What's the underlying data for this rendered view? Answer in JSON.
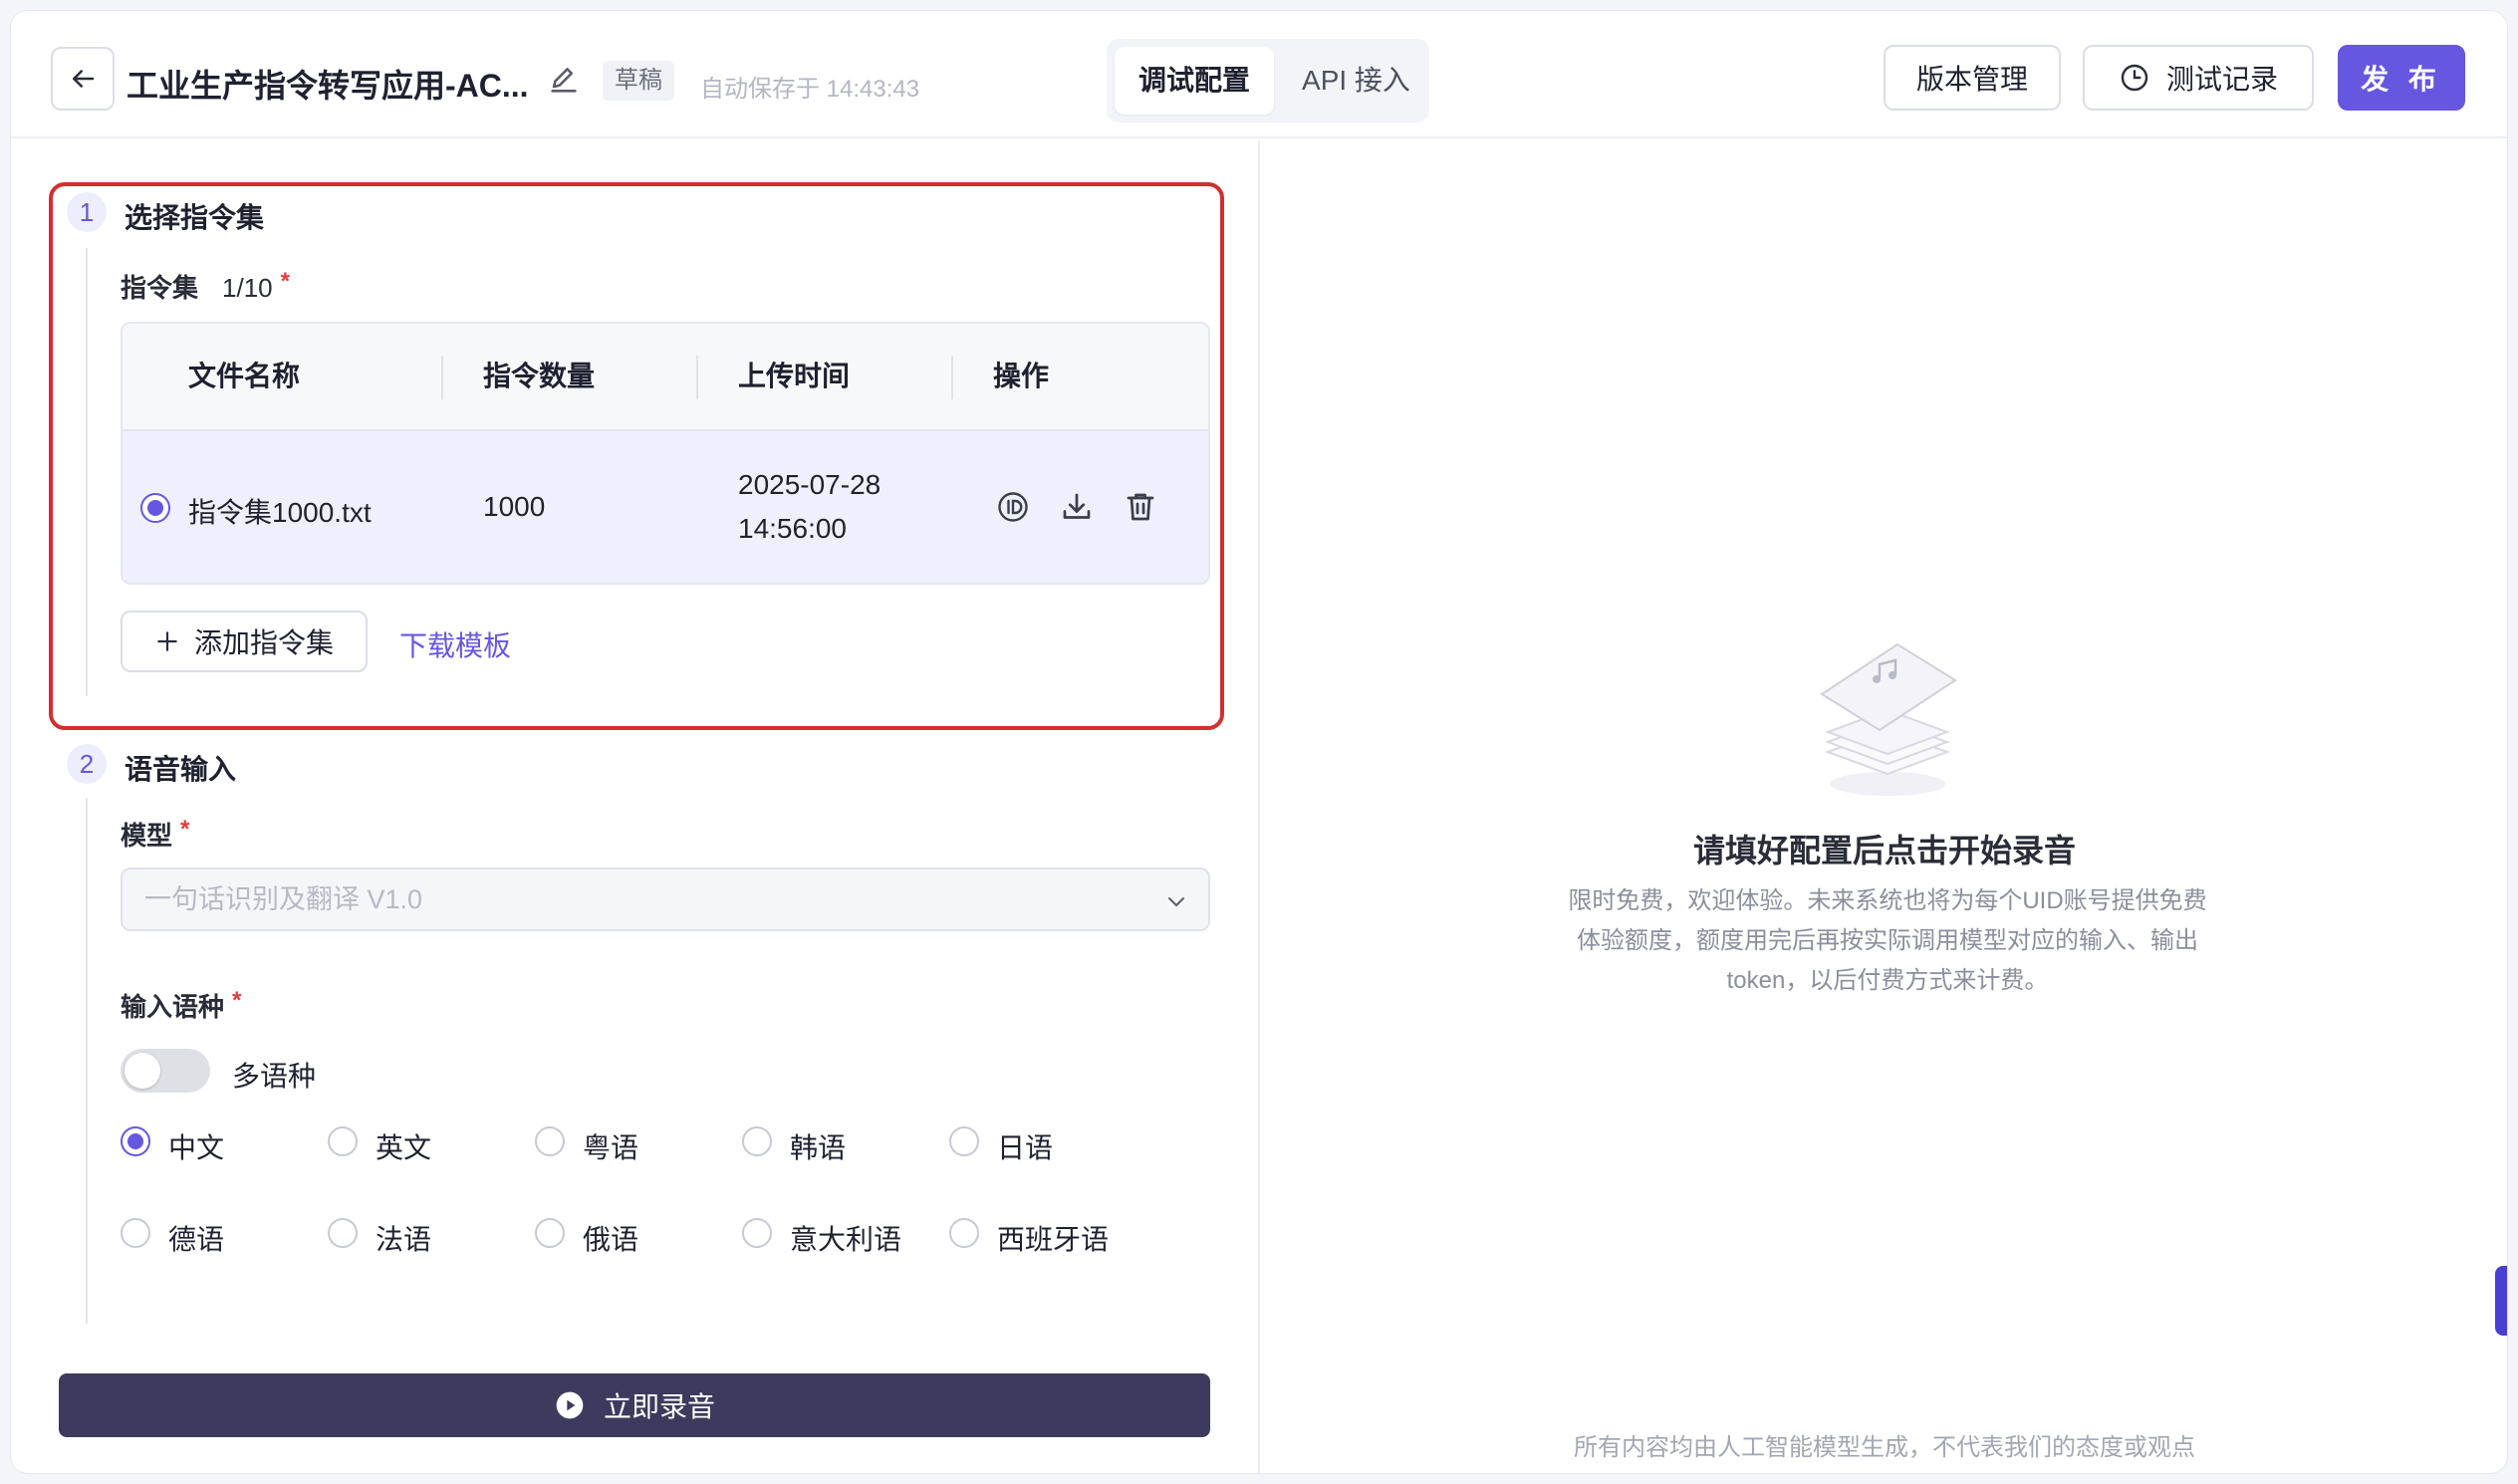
{
  "header": {
    "title": "工业生产指令转写应用-AC...",
    "draft_badge": "草稿",
    "autosave": "自动保存于 14:43:43",
    "tabs": [
      {
        "label": "调试配置",
        "active": true
      },
      {
        "label": "API 接入",
        "active": false
      }
    ],
    "version_btn": "版本管理",
    "testlog_btn": "测试记录",
    "publish_btn": "发 布"
  },
  "section1": {
    "num": "1",
    "title": "选择指令集",
    "field_label": "指令集",
    "count": "1/10",
    "required": "*",
    "columns": [
      "文件名称",
      "指令数量",
      "上传时间",
      "操作"
    ],
    "rows": [
      {
        "name": "指令集1000.txt",
        "count": "1000",
        "date": "2025-07-28",
        "time": "14:56:00",
        "selected": true
      }
    ],
    "add_btn": "添加指令集",
    "download_link": "下载模板"
  },
  "section2": {
    "num": "2",
    "title": "语音输入",
    "model_label": "模型",
    "model_required": "*",
    "model_value": "一句话识别及翻译 V1.0",
    "lang_label": "输入语种",
    "lang_required": "*",
    "multi_lang_label": "多语种",
    "multi_lang_enabled": false,
    "languages": [
      {
        "label": "中文",
        "checked": true
      },
      {
        "label": "英文",
        "checked": false
      },
      {
        "label": "粤语",
        "checked": false
      },
      {
        "label": "韩语",
        "checked": false
      },
      {
        "label": "日语",
        "checked": false
      },
      {
        "label": "德语",
        "checked": false
      },
      {
        "label": "法语",
        "checked": false
      },
      {
        "label": "俄语",
        "checked": false
      },
      {
        "label": "意大利语",
        "checked": false
      },
      {
        "label": "西班牙语",
        "checked": false
      }
    ]
  },
  "record_btn": "立即录音",
  "empty_state": {
    "title": "请填好配置后点击开始录音",
    "desc_lines": [
      "限时免费，欢迎体验。未来系统也将为每个UID账号提供免费",
      "体验额度，额度用完后再按实际调用模型对应的输入、输出",
      "token，以后付费方式来计费。"
    ]
  },
  "footer_note": "所有内容均由人工智能模型生成，不代表我们的态度或观点",
  "colors": {
    "accent": "#6557e0",
    "highlight_border": "#d42e2e",
    "record_btn_bg": "#3e3a5d",
    "selected_row_bg": "#f0effd"
  }
}
